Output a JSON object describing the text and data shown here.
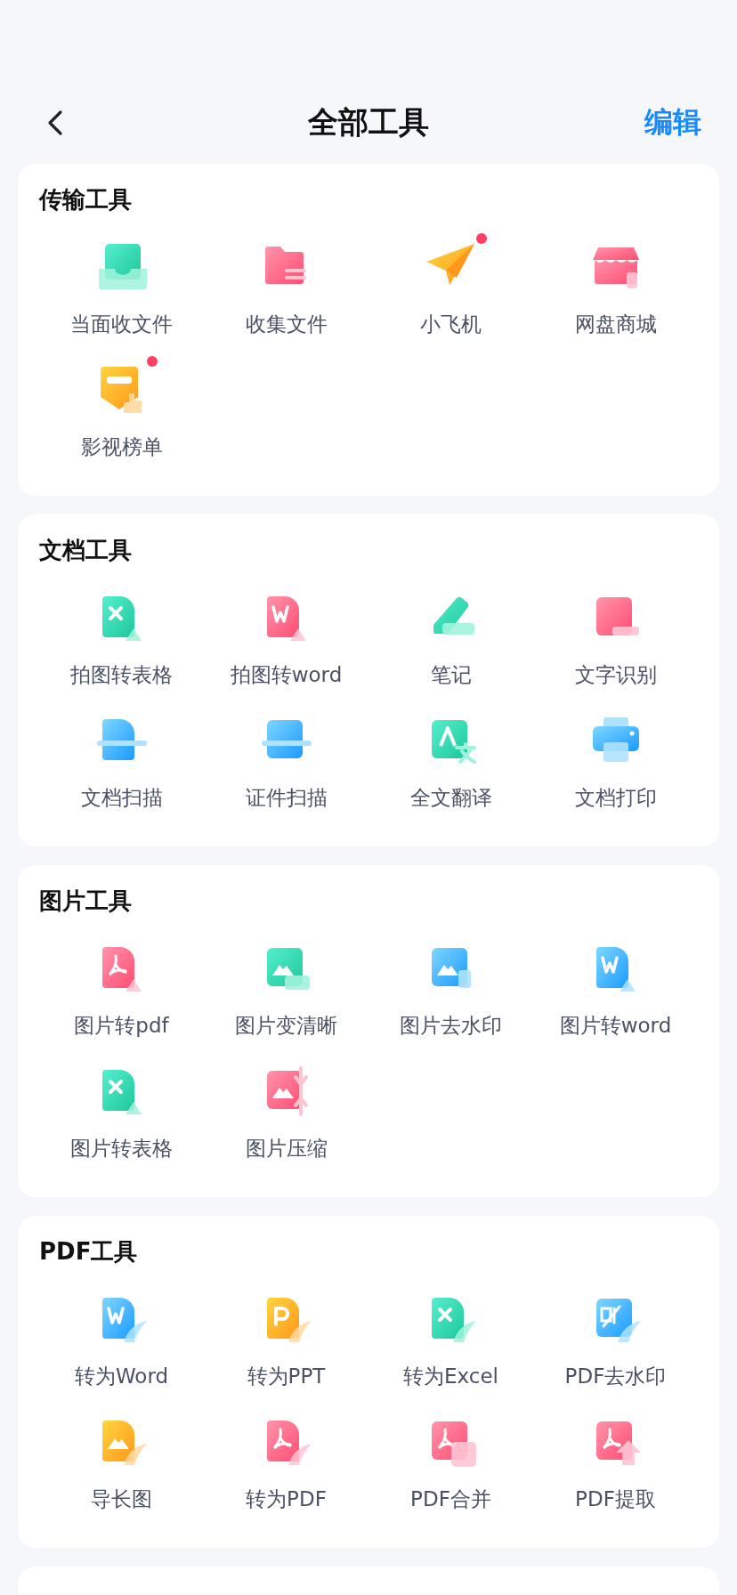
{
  "header": {
    "title": "全部工具",
    "action": "编辑"
  },
  "sections": [
    {
      "title": "传输工具",
      "tools": [
        {
          "label": "当面收文件",
          "kind": "tray",
          "badge": false
        },
        {
          "label": "收集文件",
          "kind": "folder",
          "badge": false
        },
        {
          "label": "小飞机",
          "kind": "plane",
          "badge": true
        },
        {
          "label": "网盘商城",
          "kind": "shop",
          "badge": false
        },
        {
          "label": "影视榜单",
          "kind": "ranking",
          "badge": true
        }
      ]
    },
    {
      "title": "文档工具",
      "tools": [
        {
          "label": "拍图转表格",
          "kind": "docx",
          "badge": false
        },
        {
          "label": "拍图转word",
          "kind": "docw",
          "badge": false
        },
        {
          "label": "笔记",
          "kind": "pen",
          "badge": false
        },
        {
          "label": "文字识别",
          "kind": "ocr",
          "badge": false
        },
        {
          "label": "文档扫描",
          "kind": "scandoc",
          "badge": false
        },
        {
          "label": "证件扫描",
          "kind": "scancard",
          "badge": false
        },
        {
          "label": "全文翻译",
          "kind": "translate",
          "badge": false
        },
        {
          "label": "文档打印",
          "kind": "printer",
          "badge": false
        }
      ]
    },
    {
      "title": "图片工具",
      "tools": [
        {
          "label": "图片转pdf",
          "kind": "imgpdf",
          "badge": false
        },
        {
          "label": "图片变清晰",
          "kind": "imghd",
          "badge": false
        },
        {
          "label": "图片去水印",
          "kind": "imgwater",
          "badge": false
        },
        {
          "label": "图片转word",
          "kind": "imgword",
          "badge": false
        },
        {
          "label": "图片转表格",
          "kind": "imgx",
          "badge": false
        },
        {
          "label": "图片压缩",
          "kind": "compress",
          "badge": false
        }
      ]
    },
    {
      "title": "PDF工具",
      "tools": [
        {
          "label": "转为Word",
          "kind": "pdfword",
          "badge": false
        },
        {
          "label": "转为PPT",
          "kind": "pdfppt",
          "badge": false
        },
        {
          "label": "转为Excel",
          "kind": "pdfexcel",
          "badge": false
        },
        {
          "label": "PDF去水印",
          "kind": "pdfwater",
          "badge": false
        },
        {
          "label": "导长图",
          "kind": "longimg",
          "badge": false
        },
        {
          "label": "转为PDF",
          "kind": "topdf",
          "badge": false
        },
        {
          "label": "PDF合并",
          "kind": "merge",
          "badge": false
        },
        {
          "label": "PDF提取",
          "kind": "extract",
          "badge": false
        }
      ]
    }
  ]
}
